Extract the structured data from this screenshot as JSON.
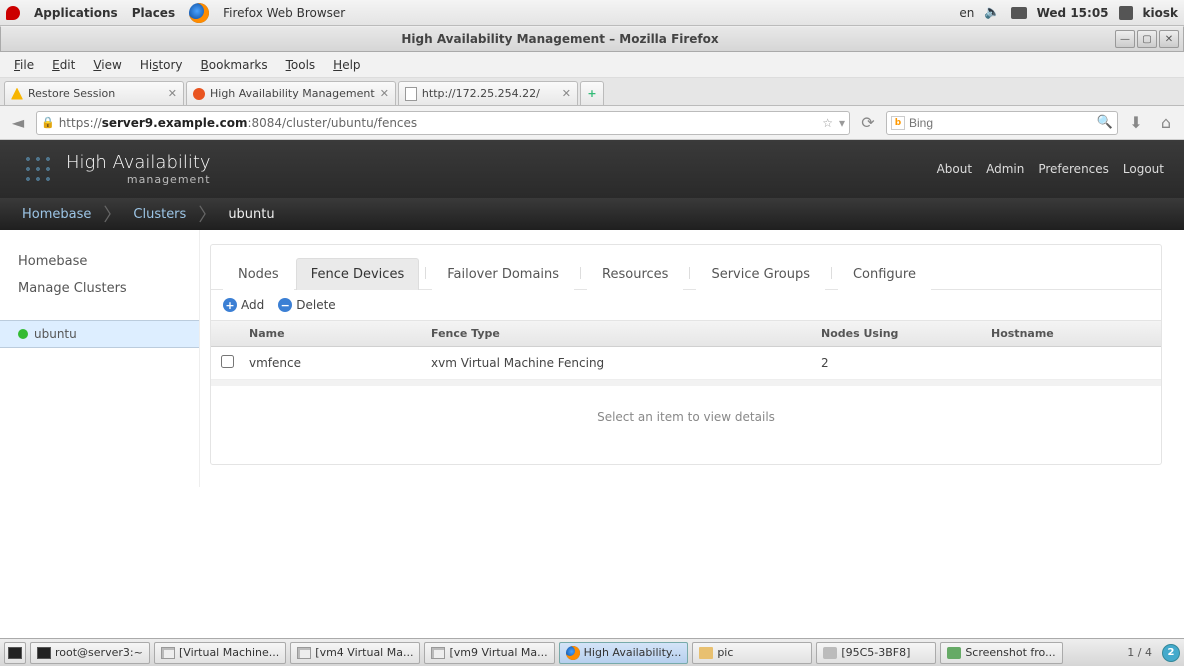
{
  "gnome": {
    "applications": "Applications",
    "places": "Places",
    "app_label": "Firefox Web Browser",
    "lang": "en",
    "clock": "Wed 15:05",
    "user": "kiosk"
  },
  "window": {
    "title": "High Availability Management – Mozilla Firefox"
  },
  "browser_menu": {
    "file": "File",
    "edit": "Edit",
    "view": "View",
    "history": "History",
    "bookmarks": "Bookmarks",
    "tools": "Tools",
    "help": "Help"
  },
  "tabs": {
    "t1": "Restore Session",
    "t2": "High Availability Management",
    "t3": "http://172.25.254.22/"
  },
  "urlbar": {
    "scheme": "https://",
    "host": "server9.example.com",
    "rest": ":8084/cluster/ubuntu/fences"
  },
  "search": {
    "engine": "b",
    "placeholder": "Bing"
  },
  "app_header": {
    "title1": "High Availability",
    "title2": "management",
    "about": "About",
    "admin": "Admin",
    "prefs": "Preferences",
    "logout": "Logout"
  },
  "breadcrumb": {
    "home": "Homebase",
    "clusters": "Clusters",
    "current": "ubuntu"
  },
  "sidebar": {
    "home": "Homebase",
    "manage": "Manage Clusters",
    "cluster": "ubuntu"
  },
  "ctabs": {
    "nodes": "Nodes",
    "fence": "Fence Devices",
    "failover": "Failover Domains",
    "resources": "Resources",
    "service": "Service Groups",
    "configure": "Configure"
  },
  "actions": {
    "add": "Add",
    "delete": "Delete"
  },
  "table": {
    "headers": {
      "name": "Name",
      "type": "Fence Type",
      "nodes": "Nodes Using",
      "host": "Hostname"
    },
    "rows": [
      {
        "name": "vmfence",
        "type": "xvm Virtual Machine Fencing",
        "nodes": "2",
        "host": ""
      }
    ]
  },
  "details_empty": "Select an item to view details",
  "taskbar": {
    "t1": "root@server3:~",
    "t2": "[Virtual Machine...",
    "t3": "[vm4 Virtual Ma...",
    "t4": "[vm9 Virtual Ma...",
    "t5": "High Availability...",
    "t6": "pic",
    "t7": "[95C5-3BF8]",
    "t8": "Screenshot fro...",
    "ws": "1 / 4",
    "badge": "2"
  }
}
